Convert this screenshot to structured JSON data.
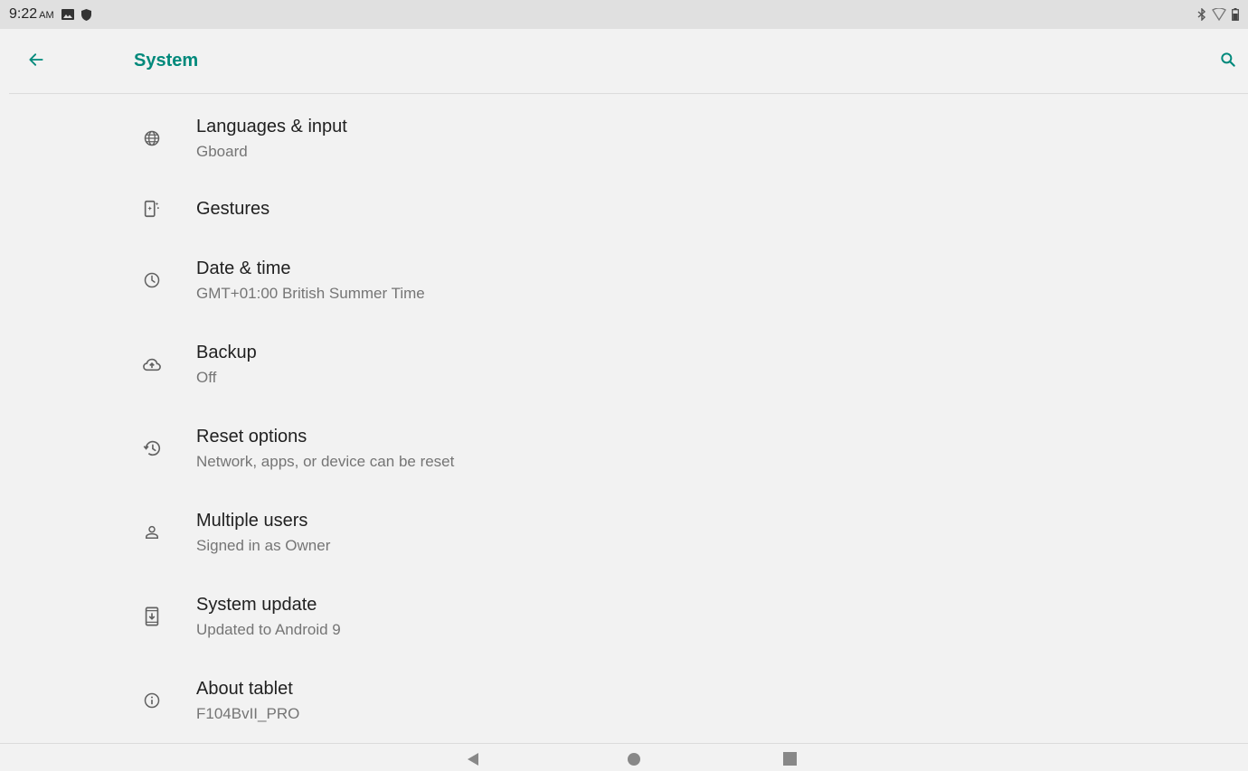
{
  "status_bar": {
    "time": "9:22",
    "ampm": "AM",
    "left_icons": [
      "image-icon",
      "shield-icon"
    ],
    "right_icons": [
      "bluetooth-icon",
      "wifi-icon",
      "battery-icon"
    ]
  },
  "app_bar": {
    "title": "System",
    "accent_color": "#00897b"
  },
  "settings": [
    {
      "title": "Languages & input",
      "summary": "Gboard",
      "icon": "globe-icon"
    },
    {
      "title": "Gestures",
      "summary": "",
      "icon": "gestures-phone-icon"
    },
    {
      "title": "Date & time",
      "summary": "GMT+01:00 British Summer Time",
      "icon": "clock-icon"
    },
    {
      "title": "Backup",
      "summary": "Off",
      "icon": "cloud-backup-icon"
    },
    {
      "title": "Reset options",
      "summary": "Network, apps, or device can be reset",
      "icon": "history-reset-icon"
    },
    {
      "title": "Multiple users",
      "summary": "Signed in as Owner",
      "icon": "person-icon"
    },
    {
      "title": "System update",
      "summary": "Updated to Android 9",
      "icon": "system-update-icon"
    },
    {
      "title": "About tablet",
      "summary": "F104BvII_PRO",
      "icon": "info-icon"
    }
  ],
  "nav_bar": {
    "icons": [
      "nav-back-icon",
      "nav-home-icon",
      "nav-recents-icon"
    ]
  }
}
